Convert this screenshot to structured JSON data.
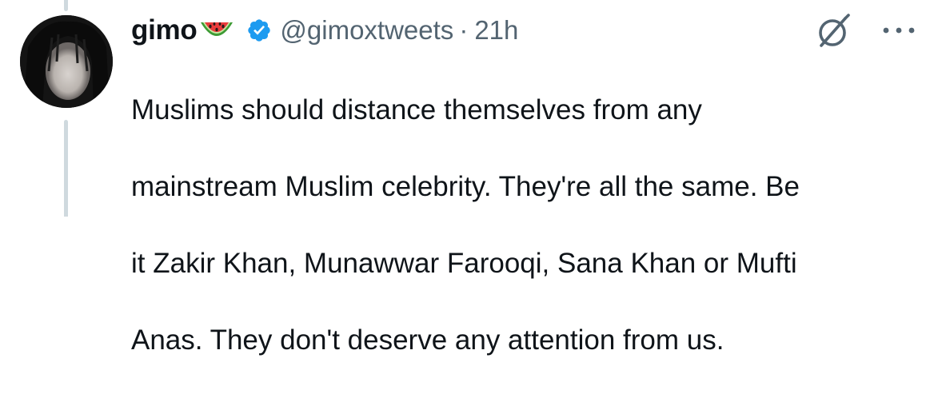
{
  "tweet": {
    "display_name": "gimo",
    "name_emoji": "watermelon-emoji",
    "verified": true,
    "handle": "@gimoxtweets",
    "separator": "·",
    "time": "21h",
    "text_lines": [
      "Muslims should distance themselves from any",
      "mainstream Muslim celebrity. They're all the same. Be",
      "it Zakir Khan, Munawwar Farooqi, Sana Khan or Mufti",
      "Anas. They don't deserve any attention from us."
    ]
  },
  "icons": {
    "verified": "verified-badge-icon",
    "grok": "grok-icon",
    "more": "more-options-icon"
  },
  "colors": {
    "verified_blue": "#1d9bf0",
    "secondary_text": "#536471",
    "primary_text": "#0f1419",
    "thread_line": "#cfd9de"
  }
}
